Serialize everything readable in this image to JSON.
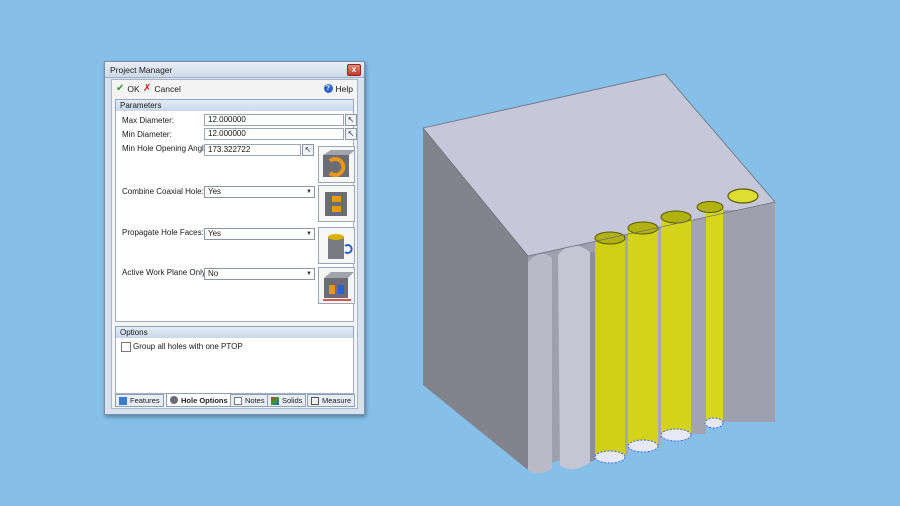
{
  "window": {
    "title": "Project Manager",
    "close_glyph": "x",
    "accent_color": "#cdd9e8"
  },
  "toolbar": {
    "ok_label": "OK",
    "cancel_label": "Cancel",
    "help_label": "Help"
  },
  "parameters": {
    "header": "Parameters",
    "max_diameter": {
      "label": "Max Diameter:",
      "value": "12.000000"
    },
    "min_diameter": {
      "label": "Min Diameter:",
      "value": "12.000000"
    },
    "min_hole_opening_angle": {
      "label": "Min Hole Opening Angle:",
      "value": "173.322722"
    },
    "combine_coaxial_hole": {
      "label": "Combine Coaxial Hole:",
      "value": "Yes"
    },
    "propagate_hole_faces": {
      "label": "Propagate Hole Faces:",
      "value": "Yes"
    },
    "active_work_plane_only": {
      "label": "Active Work Plane Only:",
      "value": "No"
    }
  },
  "options": {
    "header": "Options",
    "group_all_holes": {
      "label": "Group all holes with one PTOP",
      "checked": false
    }
  },
  "tabs": [
    {
      "label": "Features",
      "icon": "features-icon",
      "active": false
    },
    {
      "label": "Hole Options",
      "icon": "hole-options-icon",
      "active": true
    },
    {
      "label": "Notes",
      "icon": "notes-icon",
      "active": false
    },
    {
      "label": "Solids",
      "icon": "solids-icon",
      "active": false
    },
    {
      "label": "Measure",
      "icon": "measure-icon",
      "active": false
    }
  ],
  "viewport": {
    "background_color": "#86c0e9",
    "block_color": "#c4c6d6",
    "hole_color": "#d4d41a"
  }
}
